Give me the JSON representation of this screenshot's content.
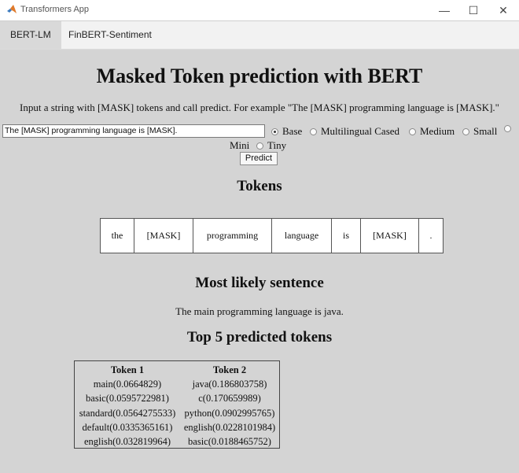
{
  "window": {
    "title": "Transformers App",
    "minimize": "—",
    "maximize": "☐",
    "close": "✕"
  },
  "tabs": [
    {
      "label": "BERT-LM"
    },
    {
      "label": "FinBERT-Sentiment"
    }
  ],
  "main": {
    "heading": "Masked Token prediction with BERT",
    "instructions": "Input a string with [MASK] tokens and call predict. For example \"The [MASK] programming language is [MASK].\"",
    "input_value": "The [MASK] programming language is [MASK].",
    "model_options": [
      "Base",
      "Multilingual Cased",
      "Medium",
      "Small",
      "Mini",
      "Tiny"
    ],
    "selected_model": "Base",
    "predict_label": "Predict",
    "tokens_heading": "Tokens",
    "tokens": [
      "the",
      "[MASK]",
      "programming",
      "language",
      "is",
      "[MASK]",
      "."
    ],
    "sentence_heading": "Most likely sentence",
    "sentence": "The main programming language is java.",
    "top5_heading": "Top 5 predicted tokens",
    "predictions": {
      "headers": [
        "Token 1",
        "Token 2"
      ],
      "token1": [
        "main(0.0664829)",
        "basic(0.0595722981)",
        "standard(0.0564275533)",
        "default(0.0335365161)",
        "english(0.032819964)"
      ],
      "token2": [
        "java(0.186803758)",
        "c(0.170659989)",
        "python(0.0902995765)",
        "english(0.0228101984)",
        "basic(0.0188465752)"
      ]
    }
  }
}
